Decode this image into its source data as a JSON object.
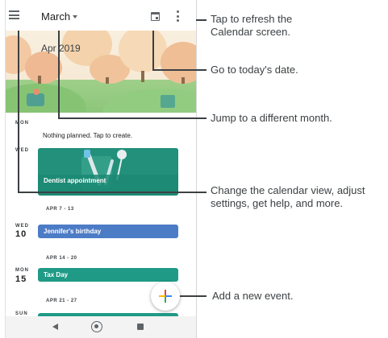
{
  "app": {
    "month_selector": "March",
    "banner_title": "Apr 2019"
  },
  "agenda": {
    "monday": {
      "weekday": "MON",
      "empty_text": "Nothing planned. Tap to create."
    },
    "wednesday": {
      "weekday": "WED",
      "event": "Dentist appointment"
    },
    "week_ranges": [
      "APR 7 - 13",
      "APR 14 - 20",
      "APR 21 - 27"
    ],
    "birthday": {
      "weekday": "WED",
      "day": "10",
      "event": "Jennifer's birthday"
    },
    "tax_day": {
      "weekday": "MON",
      "day": "15",
      "event": "Tax Day"
    },
    "sunday": {
      "weekday": "SUN"
    }
  },
  "callouts": {
    "refresh": "Tap to refresh the Calendar screen.",
    "today": "Go to today's date.",
    "month": "Jump to a different month.",
    "menu": "Change the calendar view, adjust settings, get help, and more.",
    "add": "Add a new event."
  },
  "colors": {
    "event_teal": "#22907b",
    "event_blue": "#4d7cc6",
    "fab_plus": [
      "#ea4335",
      "#fbbc04",
      "#34a853",
      "#4285f4"
    ]
  },
  "icons": {
    "menu": "hamburger-menu-icon",
    "today": "calendar-today-icon",
    "more": "more-vert-icon",
    "add": "plus-icon",
    "back": "back-triangle-icon",
    "home": "home-circle-icon",
    "recent": "recent-apps-square-icon"
  }
}
